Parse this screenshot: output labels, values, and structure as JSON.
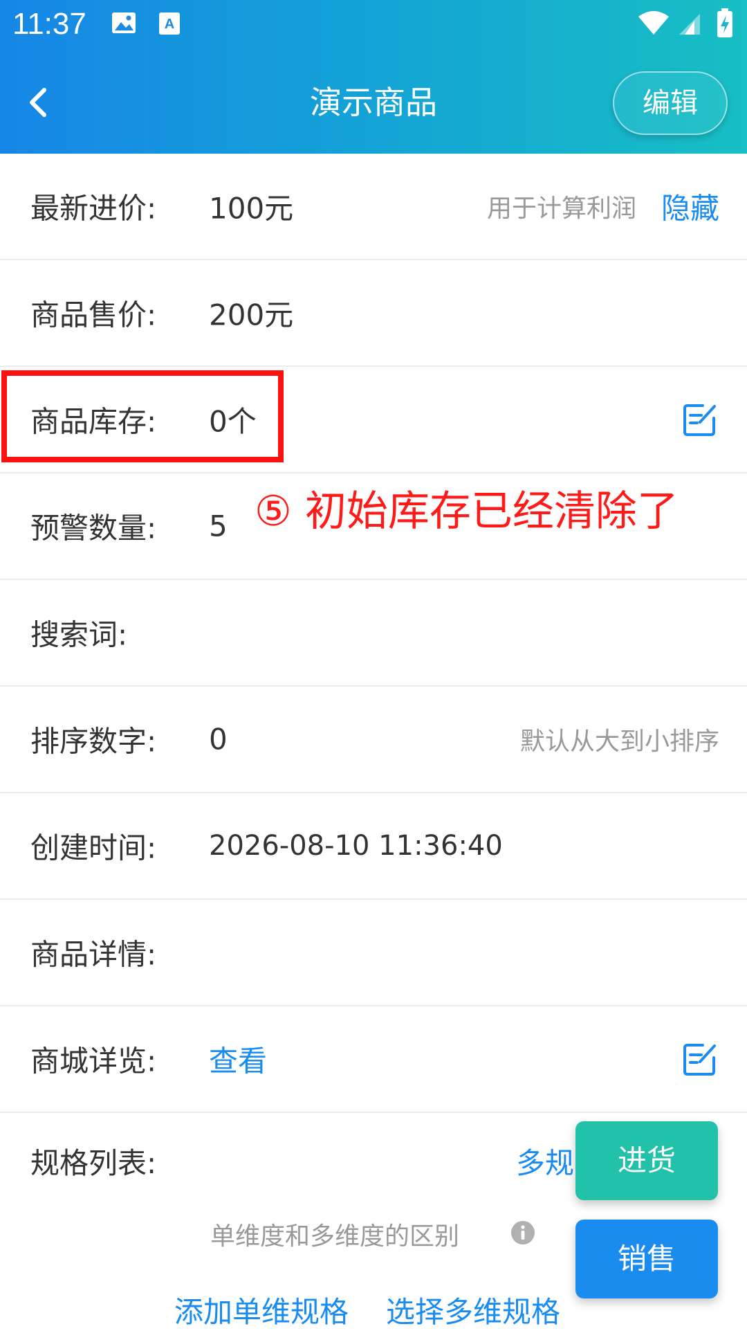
{
  "status_bar": {
    "time": "11:37"
  },
  "navbar": {
    "title": "演示商品",
    "edit_label": "编辑"
  },
  "rows": {
    "latest_cost": {
      "label": "最新进价:",
      "value": "100元",
      "hint": "用于计算利润",
      "action": "隐藏"
    },
    "sale_price": {
      "label": "商品售价:",
      "value": "200元"
    },
    "stock": {
      "label": "商品库存:",
      "value": "0个"
    },
    "alert_qty": {
      "label": "预警数量:",
      "value": "5"
    },
    "search_words": {
      "label": "搜索词:",
      "value": ""
    },
    "sort_number": {
      "label": "排序数字:",
      "value": "0",
      "hint": "默认从大到小排序"
    },
    "created_at": {
      "label": "创建时间:",
      "value": "2026-08-10 11:36:40"
    },
    "details": {
      "label": "商品详情:",
      "value": ""
    },
    "mall_preview": {
      "label": "商城详览:",
      "value": "查看"
    }
  },
  "annotation": {
    "text": "⑤ 初始库存已经清除了",
    "color": "#ff1a1a"
  },
  "specs": {
    "label": "规格列表:",
    "multi_partial": "多规",
    "hint": "单维度和多维度的区别",
    "add_single": "添加单维规格",
    "select_multi": "选择多维规格"
  },
  "fabs": {
    "purchase": "进货",
    "sale": "销售"
  },
  "colors": {
    "accent": "#1a8cf0",
    "purchase": "#22c1a9",
    "highlight": "#ff1010"
  }
}
